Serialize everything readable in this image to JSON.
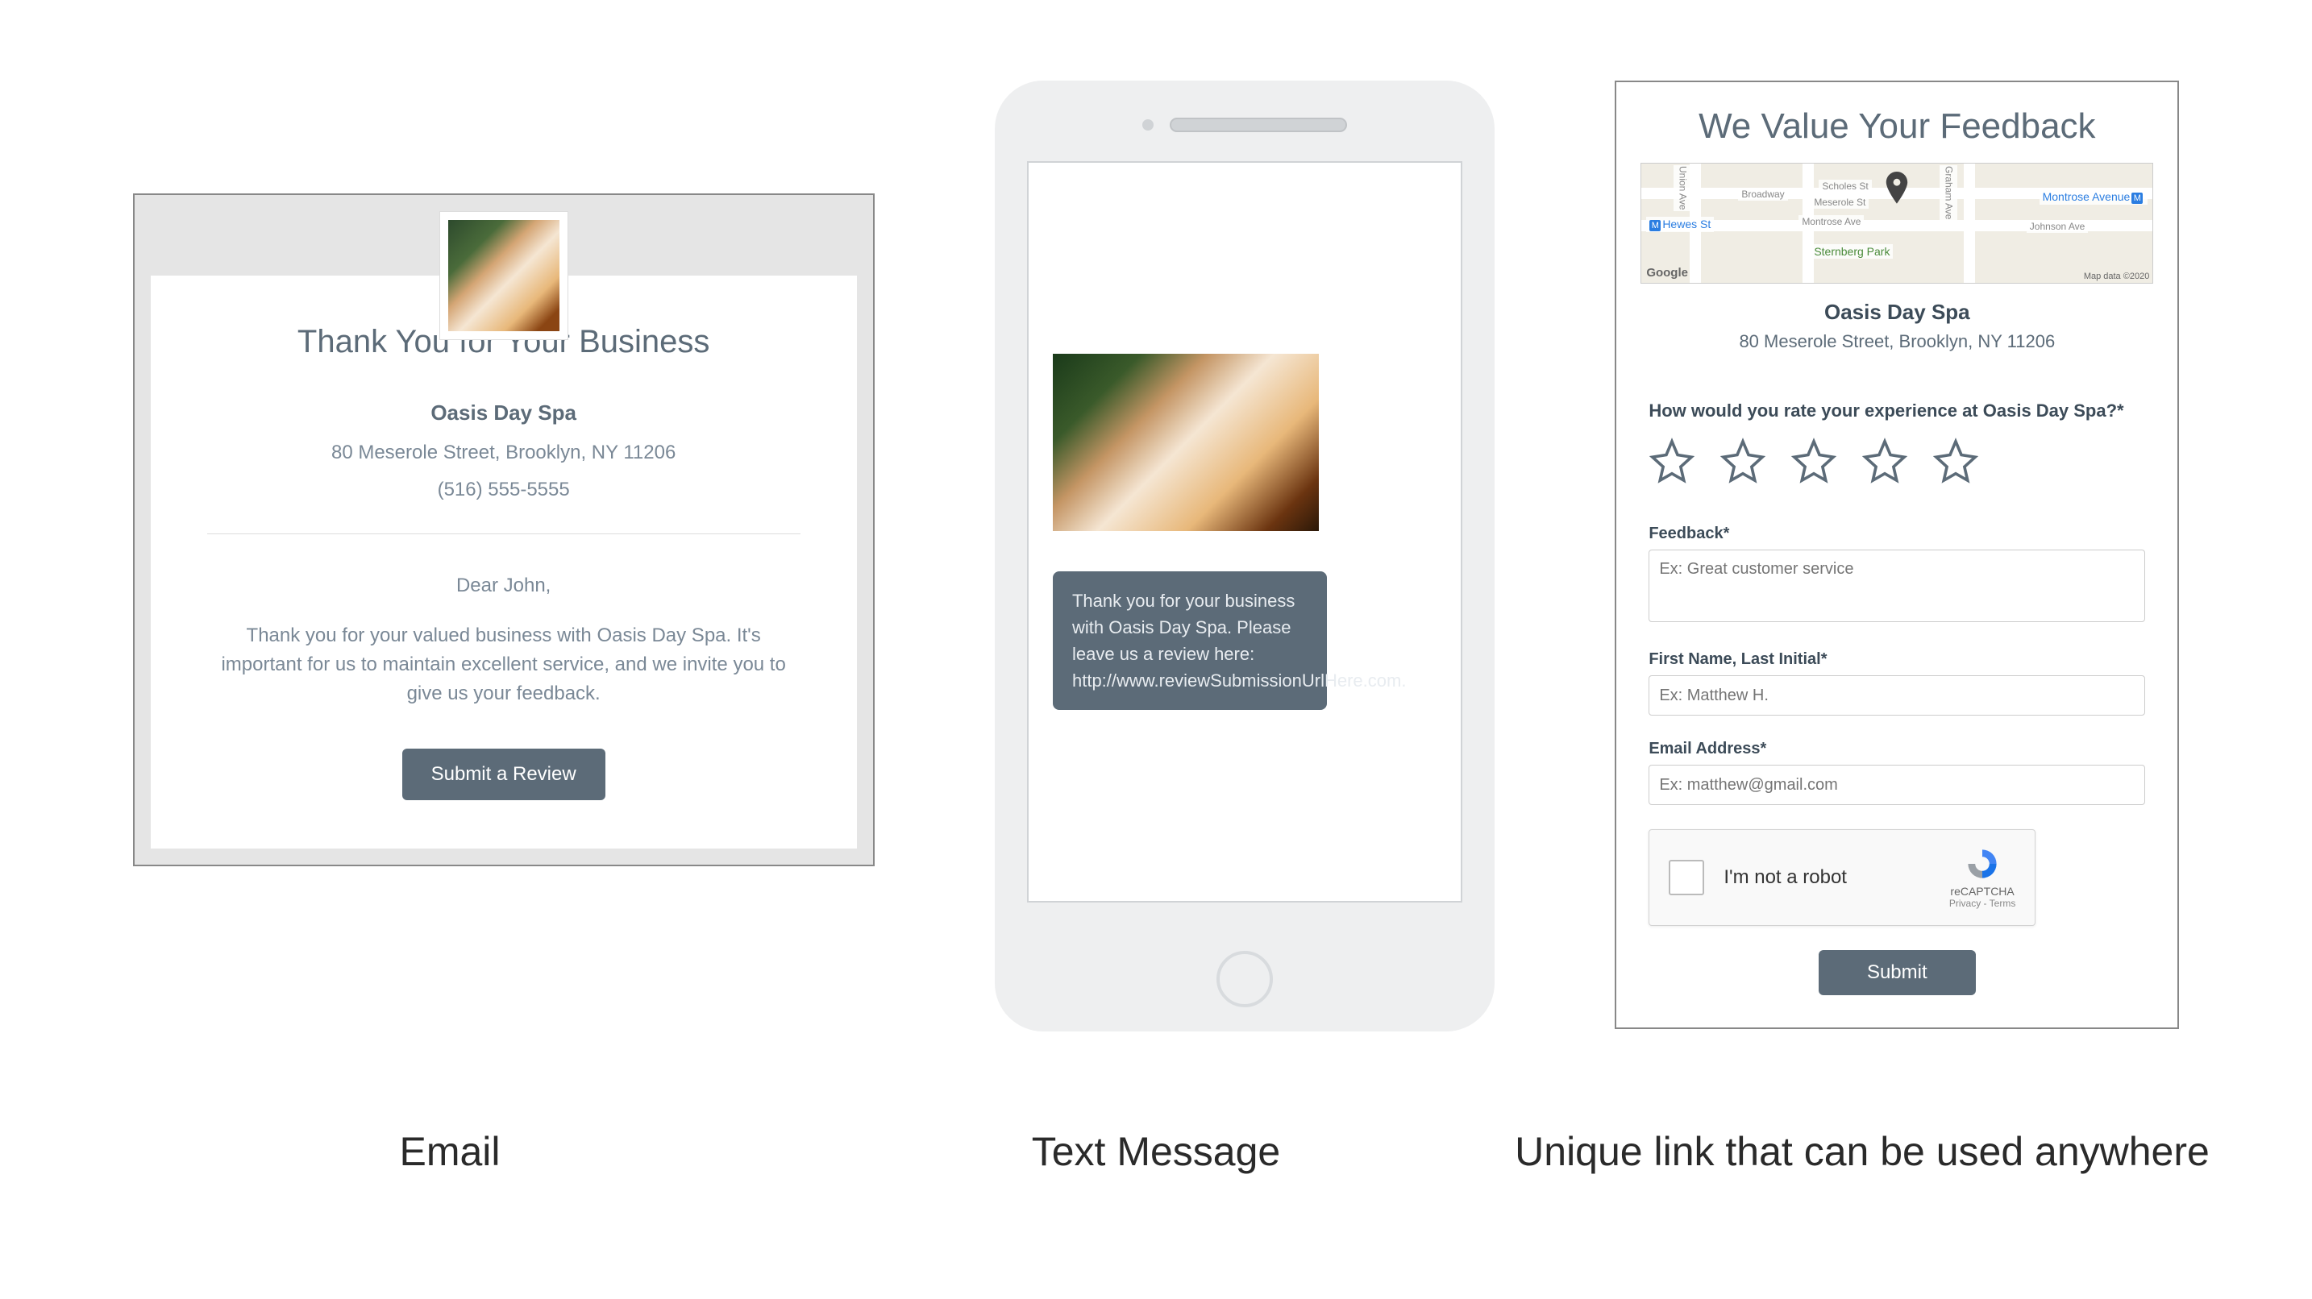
{
  "captions": {
    "email": "Email",
    "text": "Text Message",
    "link": "Unique link that can be used anywhere"
  },
  "email": {
    "title": "Thank You for Your Business",
    "business": "Oasis Day Spa",
    "address": "80 Meserole Street, Brooklyn, NY 11206",
    "phone": "(516) 555-5555",
    "greeting": "Dear John,",
    "body": "Thank you for your valued business with Oasis Day Spa. It's important for us to maintain excellent service, and we invite you to give us your feedback.",
    "button": "Submit a Review"
  },
  "sms": {
    "message": "Thank you for your business with Oasis Day Spa. Please leave us a review here: http://www.reviewSubmissionUrlHere.com."
  },
  "form": {
    "title": "We Value Your Feedback",
    "business": "Oasis Day Spa",
    "address": "80 Meserole Street, Brooklyn, NY 11206",
    "rating_question": "How would you rate your experience at Oasis Day Spa?*",
    "feedback_label": "Feedback*",
    "feedback_placeholder": "Ex: Great customer service",
    "name_label": "First Name, Last Initial*",
    "name_placeholder": "Ex: Matthew H.",
    "email_label": "Email Address*",
    "email_placeholder": "Ex: matthew@gmail.com",
    "recaptcha_text": "I'm not a robot",
    "recaptcha_brand": "reCAPTCHA",
    "recaptcha_terms": "Privacy - Terms",
    "submit": "Submit",
    "map": {
      "google": "Google",
      "attr": "Map data ©2020",
      "labels": {
        "hewes": "Hewes St",
        "broadway": "Broadway",
        "scholes": "Scholes St",
        "meserole": "Meserole St",
        "montrose_ave": "Montrose Ave",
        "montrose_avenue": "Montrose Avenue",
        "johnson": "Johnson Ave",
        "sternberg": "Sternberg Park",
        "graham": "Graham Ave",
        "union": "Union Ave"
      }
    }
  }
}
